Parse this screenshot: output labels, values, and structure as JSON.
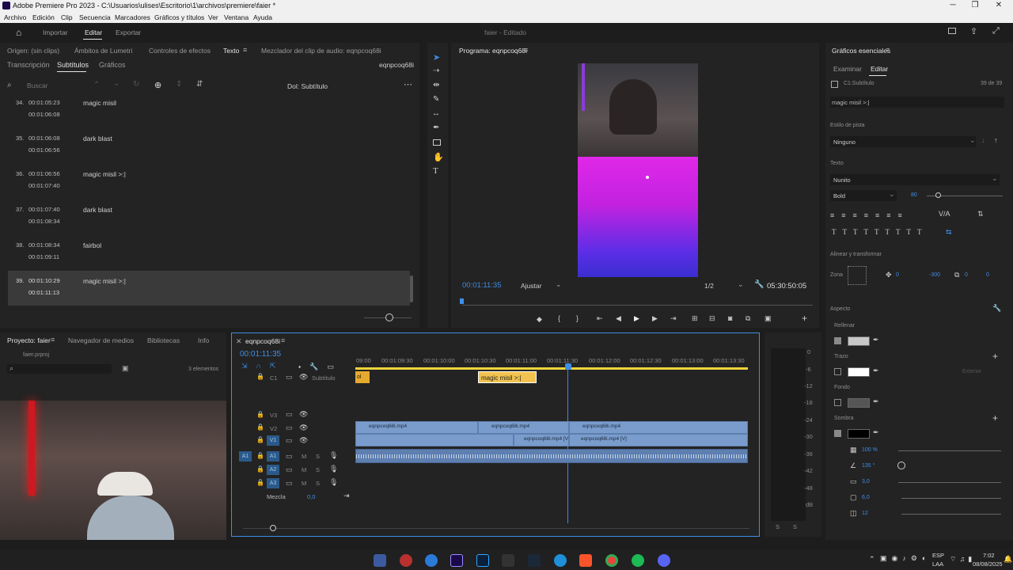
{
  "window": {
    "title": "Adobe Premiere Pro 2023 - C:\\Usuarios\\ulises\\Escritorio\\1\\archivos\\premiere\\faier *"
  },
  "menu": [
    "Archivo",
    "Edición",
    "Clip",
    "Secuencia",
    "Marcadores",
    "Gráficos y títulos",
    "Ver",
    "Ventana",
    "Ayuda"
  ],
  "workspace": {
    "tabs": [
      "Importar",
      "Editar",
      "Exportar"
    ],
    "project_status": "faier - Editado"
  },
  "text_panel": {
    "tabs": [
      "Origen: (sin clips)",
      "Ámbitos de Lumetri",
      "Controles de efectos",
      "Texto",
      "Mezclador del clip de audio: eqnpcoq68i"
    ],
    "subtabs": [
      "Transcripción",
      "Subtítulos",
      "Gráficos"
    ],
    "sequence": "eqnpcoq68i",
    "search_placeholder": "Buscar",
    "track_label": "Dol: Subtítulo",
    "captions": [
      {
        "n": "34.",
        "start": "00:01:05:23",
        "end": "00:01:06:08",
        "text": "magic misil"
      },
      {
        "n": "35.",
        "start": "00:01:06:08",
        "end": "00:01:06:56",
        "text": "dark blast"
      },
      {
        "n": "36.",
        "start": "00:01:06:56",
        "end": "00:01:07:40",
        "text": "magic misil >:|"
      },
      {
        "n": "37.",
        "start": "00:01:07:40",
        "end": "00:01:08:34",
        "text": "dark blast"
      },
      {
        "n": "38.",
        "start": "00:01:08:34",
        "end": "00:01:09:11",
        "text": "fairbol"
      },
      {
        "n": "39.",
        "start": "00:01:10:29",
        "end": "00:01:11:13",
        "text": "magic misil >:|"
      }
    ]
  },
  "program": {
    "title": "Programa: eqnpcoq68i",
    "timecode": "00:01:11:35",
    "fit": "Ajustar",
    "ratio": "1/2",
    "duration": "05:30:50:05"
  },
  "essential": {
    "title": "Gráficos esenciales",
    "tabs": [
      "Examinar",
      "Editar"
    ],
    "layer": "C1:Subtítulo",
    "count": "39 de 39",
    "text_value": "magic misil >:|",
    "track_style_label": "Estilo de pista",
    "track_style": "Ninguno",
    "text_label": "Texto",
    "font": "Nunito",
    "weight": "Bold",
    "size": "80",
    "align_label": "Alinear y transformar",
    "zone_label": "Zona",
    "pos_x": "0",
    "pos_y": "-300",
    "scale": "0",
    "rot": "0",
    "appearance_label": "Aspecto",
    "fill_label": "Rellenar",
    "stroke_label": "Trazo",
    "stroke_mode": "Exterior",
    "bg_label": "Fondo",
    "shadow_label": "Sombra",
    "shadow_opacity": "100 %",
    "shadow_angle": "135 °",
    "shadow_distance": "3,0",
    "shadow_size": "6,0",
    "shadow_blur": "12",
    "colors": {
      "fill": "#c8c8c8",
      "stroke": "#ffffff",
      "bg": "#555555",
      "shadow": "#000000"
    }
  },
  "project": {
    "tabs": [
      "Proyecto: faier",
      "Navegador de medios",
      "Bibliotecas",
      "Info"
    ],
    "file": "faier.prproj",
    "items": "3 elementos"
  },
  "timeline": {
    "seq": "eqnpcoq68i",
    "timecode": "00:01:11:35",
    "ruler": [
      "09:00",
      "00:01:09:30",
      "00:01:10:00",
      "00:01:10:30",
      "00:01:11:00",
      "00:01:11:30",
      "00:01:12:00",
      "00:01:12:30",
      "00:01:13:00",
      "00:01:13:30"
    ],
    "subtitle_track": "Subtítulo",
    "sub_clip_prev": "ol",
    "sub_clip": "magic misil >:|",
    "tracks": [
      "V3",
      "V2",
      "V1",
      "A1",
      "A2",
      "A3"
    ],
    "src_v": "V1",
    "src_a": "A1",
    "c1": "C1",
    "mix_label": "Mezcla",
    "mix_value": "0,0",
    "clips_v2": [
      "eqnpcoq68i.mp4",
      "eqnpcoq68i.mp4",
      "eqnpcoq68i.mp4"
    ],
    "clips_v1": [
      "eqnpcoq68i.mp4 [V]",
      "eqnpcoq68i.mp4 [V]"
    ],
    "meter": [
      "0",
      "-6",
      "-12",
      "-18",
      "-24",
      "-30",
      "-36",
      "-42",
      "-48",
      "dB"
    ],
    "solo": [
      "S",
      "S"
    ]
  },
  "taskbar": {
    "lang1": "ESP",
    "lang2": "LAA",
    "time": "7:02",
    "date": "08/08/2025"
  }
}
